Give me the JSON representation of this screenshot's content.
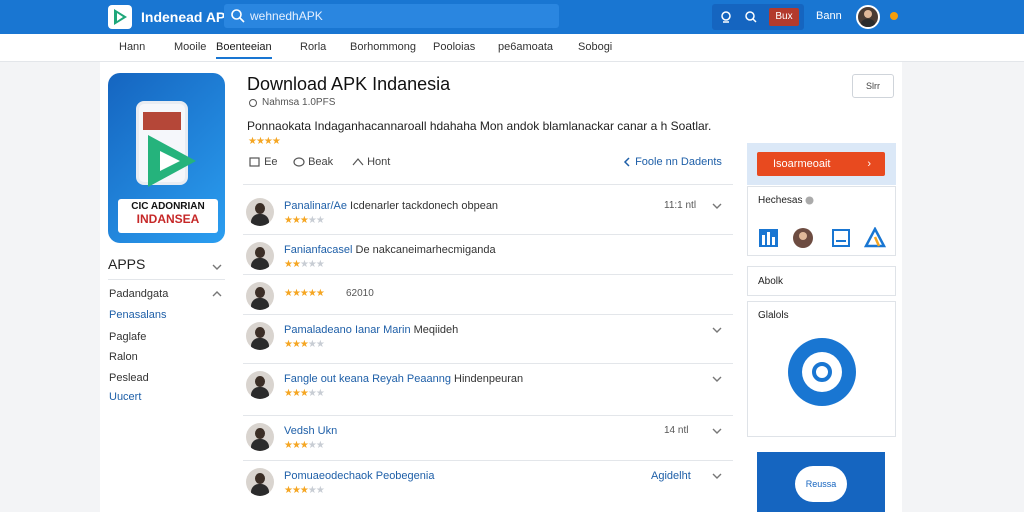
{
  "header": {
    "brand": "Indenead AP",
    "search_value": "wehnedhAPK",
    "badge_label": "Bux",
    "user_label": "Bann"
  },
  "nav": {
    "items": [
      "Hann",
      "Mooile",
      "Boenteeian",
      "Rorla",
      "Borhommong",
      "Pooloias",
      "pe6amoata",
      "Sobogi"
    ]
  },
  "app": {
    "icon_line1": "CIC ADONRIAN",
    "icon_line2": "INDANSEA",
    "title": "Download APK Indanesia",
    "meta": "Nahmsa 1.0PFS",
    "description": "Ponnaokata Indaganhacannaroall hdahaha Mon andok blamlanackar canar a h Soatlar.",
    "rating_stars": "★★★★",
    "actions": {
      "like": "Ee",
      "comment": "Beak",
      "share": "Hont"
    },
    "share_link": "Foole nn Dadents",
    "top_button": "Slrr"
  },
  "sidebar": {
    "title": "APPS",
    "items": [
      {
        "label": "Padandgata",
        "blue": false
      },
      {
        "label": "Penasalans",
        "blue": true
      },
      {
        "label": "Paglafe",
        "blue": false
      },
      {
        "label": "Ralon",
        "blue": false
      },
      {
        "label": "Peslead",
        "blue": false
      },
      {
        "label": "Uucert",
        "blue": true
      }
    ]
  },
  "reviews": [
    {
      "name": "Panalinar/Ae",
      "text": " Icdenarler tackdonech obpean",
      "stars": 3,
      "time": "11:1 ntl"
    },
    {
      "name": "Fanianfacasel",
      "text": " De nakcaneimarhecmiganda",
      "stars": 2,
      "time": ""
    },
    {
      "name": "",
      "text": "",
      "stars": 5,
      "time": "62010"
    },
    {
      "name": "Pamaladeano Ianar Marin",
      "text": " Meqiideh",
      "stars": 3,
      "time": ""
    },
    {
      "name": "Fangle out keana Reyah Peaanng",
      "text": " Hindenpeuran",
      "stars": 3,
      "time": ""
    },
    {
      "name": "Vedsh Ukn",
      "text": "",
      "stars": 3,
      "time": "14 ntl"
    },
    {
      "name": "Pomuaeodechaok Peobegenia",
      "text": "",
      "stars": 3,
      "time": "Agidelht"
    }
  ],
  "right": {
    "install_label": "Isoarmeoait",
    "box1_label": "Hechesas",
    "box2_label": "Abolk",
    "box3_label": "Glalols",
    "promo_label": "Reussa"
  },
  "colors": {
    "header_bg": "#1976d2",
    "accent": "#1e5fa8",
    "install": "#e84a1f",
    "star": "#f5a623"
  }
}
